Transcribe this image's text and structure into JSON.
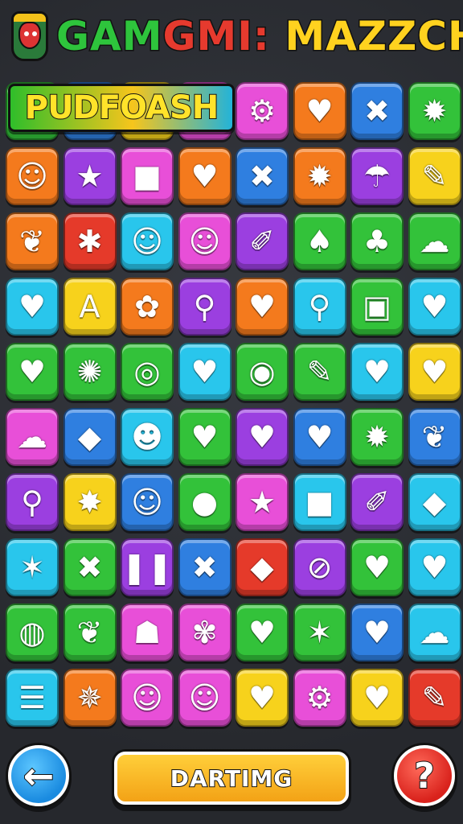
{
  "title": {
    "part1": "GAM",
    "part2": "GMI:",
    "part3": " MAZZCH"
  },
  "banner": {
    "text": "PUDFOASH"
  },
  "colors": {
    "green": "#33c23a",
    "blue": "#2f7fe0",
    "purple": "#9b3fe0",
    "yellow": "#f7d21c",
    "orange": "#f47a1d",
    "red": "#e53a2a",
    "pink": "#e84fd8",
    "cyan": "#29c6ec"
  },
  "board": {
    "rows": [
      [
        {
          "color": "green",
          "icon": "blank-icon",
          "glyph": ""
        },
        {
          "color": "blue",
          "icon": "blank-icon",
          "glyph": ""
        },
        {
          "color": "yellow",
          "icon": "blank-icon",
          "glyph": ""
        },
        {
          "color": "pink",
          "icon": "blank-icon",
          "glyph": ""
        },
        {
          "color": "pink",
          "icon": "gear-icon",
          "glyph": "⚙"
        },
        {
          "color": "orange",
          "icon": "heart-icon",
          "glyph": "♥"
        },
        {
          "color": "blue",
          "icon": "cross-icon",
          "glyph": "✖"
        },
        {
          "color": "green",
          "icon": "star-icon",
          "glyph": "✹"
        }
      ],
      [
        {
          "color": "orange",
          "icon": "fruit-face-icon",
          "glyph": "☺"
        },
        {
          "color": "purple",
          "icon": "star-icon",
          "glyph": "★"
        },
        {
          "color": "pink",
          "icon": "square-icon",
          "glyph": "■"
        },
        {
          "color": "orange",
          "icon": "heart-icon",
          "glyph": "♥"
        },
        {
          "color": "blue",
          "icon": "cross-icon",
          "glyph": "✖"
        },
        {
          "color": "orange",
          "icon": "sun-icon",
          "glyph": "✹"
        },
        {
          "color": "purple",
          "icon": "mushroom-icon",
          "glyph": "☂"
        },
        {
          "color": "yellow",
          "icon": "candy-icon",
          "glyph": "✎"
        }
      ],
      [
        {
          "color": "orange",
          "icon": "leaf-icon",
          "glyph": "❦"
        },
        {
          "color": "red",
          "icon": "asterisk-icon",
          "glyph": "✱"
        },
        {
          "color": "cyan",
          "icon": "cat-face-icon",
          "glyph": "☺"
        },
        {
          "color": "pink",
          "icon": "cat-face-icon",
          "glyph": "☺"
        },
        {
          "color": "purple",
          "icon": "bone-icon",
          "glyph": "✐"
        },
        {
          "color": "green",
          "icon": "heart-icon",
          "glyph": "♠"
        },
        {
          "color": "green",
          "icon": "cupcake-icon",
          "glyph": "♣"
        },
        {
          "color": "green",
          "icon": "cloud-icon",
          "glyph": "☁"
        }
      ],
      [
        {
          "color": "cyan",
          "icon": "heart-icon",
          "glyph": "♥"
        },
        {
          "color": "yellow",
          "icon": "letter-a-icon",
          "glyph": "A"
        },
        {
          "color": "orange",
          "icon": "flower-face-icon",
          "glyph": "✿"
        },
        {
          "color": "purple",
          "icon": "magnifier-icon",
          "glyph": "⚲"
        },
        {
          "color": "orange",
          "icon": "heart-icon",
          "glyph": "♥"
        },
        {
          "color": "cyan",
          "icon": "magnifier-icon",
          "glyph": "⚲"
        },
        {
          "color": "green",
          "icon": "robot-icon",
          "glyph": "▣"
        },
        {
          "color": "cyan",
          "icon": "heart-icon",
          "glyph": "♥"
        }
      ],
      [
        {
          "color": "green",
          "icon": "heart-icon",
          "glyph": "♥"
        },
        {
          "color": "green",
          "icon": "splat-icon",
          "glyph": "✺"
        },
        {
          "color": "green",
          "icon": "magnifier-icon",
          "glyph": "◎"
        },
        {
          "color": "cyan",
          "icon": "heart-icon",
          "glyph": "♥"
        },
        {
          "color": "green",
          "icon": "map-pin-icon",
          "glyph": "◉"
        },
        {
          "color": "green",
          "icon": "pencil-icon",
          "glyph": "✎"
        },
        {
          "color": "cyan",
          "icon": "heart-icon",
          "glyph": "♥"
        },
        {
          "color": "yellow",
          "icon": "heart-icon",
          "glyph": "♥"
        }
      ],
      [
        {
          "color": "pink",
          "icon": "swirl-icon",
          "glyph": "☁"
        },
        {
          "color": "blue",
          "icon": "drop-icon",
          "glyph": "◆"
        },
        {
          "color": "cyan",
          "icon": "bird-icon",
          "glyph": "☻"
        },
        {
          "color": "green",
          "icon": "heart-icon",
          "glyph": "♥"
        },
        {
          "color": "purple",
          "icon": "heart-icon",
          "glyph": "♥"
        },
        {
          "color": "blue",
          "icon": "heart-icon",
          "glyph": "♥"
        },
        {
          "color": "green",
          "icon": "sun-icon",
          "glyph": "✹"
        },
        {
          "color": "blue",
          "icon": "leaf-icon",
          "glyph": "❦"
        }
      ],
      [
        {
          "color": "purple",
          "icon": "magnifier-icon",
          "glyph": "⚲"
        },
        {
          "color": "yellow",
          "icon": "star-icon",
          "glyph": "✸"
        },
        {
          "color": "blue",
          "icon": "ghost-face-icon",
          "glyph": "☺"
        },
        {
          "color": "green",
          "icon": "speech-bubble-icon",
          "glyph": "●"
        },
        {
          "color": "pink",
          "icon": "star-icon",
          "glyph": "★"
        },
        {
          "color": "cyan",
          "icon": "speech-bubble-icon",
          "glyph": "■"
        },
        {
          "color": "purple",
          "icon": "candy-icon",
          "glyph": "✐"
        },
        {
          "color": "cyan",
          "icon": "speech-bubble-icon",
          "glyph": "◆"
        }
      ],
      [
        {
          "color": "cyan",
          "icon": "star-icon",
          "glyph": "✶"
        },
        {
          "color": "green",
          "icon": "cross-icon",
          "glyph": "✖"
        },
        {
          "color": "purple",
          "icon": "pause-icon",
          "glyph": "❚❚"
        },
        {
          "color": "blue",
          "icon": "cross-icon",
          "glyph": "✖"
        },
        {
          "color": "red",
          "icon": "fish-icon",
          "glyph": "◆"
        },
        {
          "color": "purple",
          "icon": "no-entry-icon",
          "glyph": "⊘"
        },
        {
          "color": "green",
          "icon": "heart-icon",
          "glyph": "♥"
        },
        {
          "color": "cyan",
          "icon": "shield-icon",
          "glyph": "♥"
        }
      ],
      [
        {
          "color": "green",
          "icon": "ball-icon",
          "glyph": "◍"
        },
        {
          "color": "green",
          "icon": "leaf-icon",
          "glyph": "❦"
        },
        {
          "color": "pink",
          "icon": "pudding-icon",
          "glyph": "☗"
        },
        {
          "color": "pink",
          "icon": "octopus-icon",
          "glyph": "✾"
        },
        {
          "color": "green",
          "icon": "heart-icon",
          "glyph": "♥"
        },
        {
          "color": "green",
          "icon": "star-icon",
          "glyph": "✶"
        },
        {
          "color": "blue",
          "icon": "heart-icon",
          "glyph": "♥"
        },
        {
          "color": "cyan",
          "icon": "cloud-icon",
          "glyph": "☁"
        }
      ],
      [
        {
          "color": "cyan",
          "icon": "notepad-icon",
          "glyph": "☰"
        },
        {
          "color": "orange",
          "icon": "maple-leaf-icon",
          "glyph": "✵"
        },
        {
          "color": "pink",
          "icon": "cat-face-icon",
          "glyph": "☺"
        },
        {
          "color": "pink",
          "icon": "cat-face-icon",
          "glyph": "☺"
        },
        {
          "color": "yellow",
          "icon": "heart-icon",
          "glyph": "♥"
        },
        {
          "color": "pink",
          "icon": "gear-icon",
          "glyph": "⚙"
        },
        {
          "color": "yellow",
          "icon": "heart-icon",
          "glyph": "♥"
        },
        {
          "color": "red",
          "icon": "pencil-icon",
          "glyph": "✎"
        }
      ]
    ]
  },
  "controls": {
    "back_icon": "arrow-left-icon",
    "back_glyph": "←",
    "main_label": "DARTIMG",
    "help_icon": "question-icon",
    "help_glyph": "?"
  }
}
